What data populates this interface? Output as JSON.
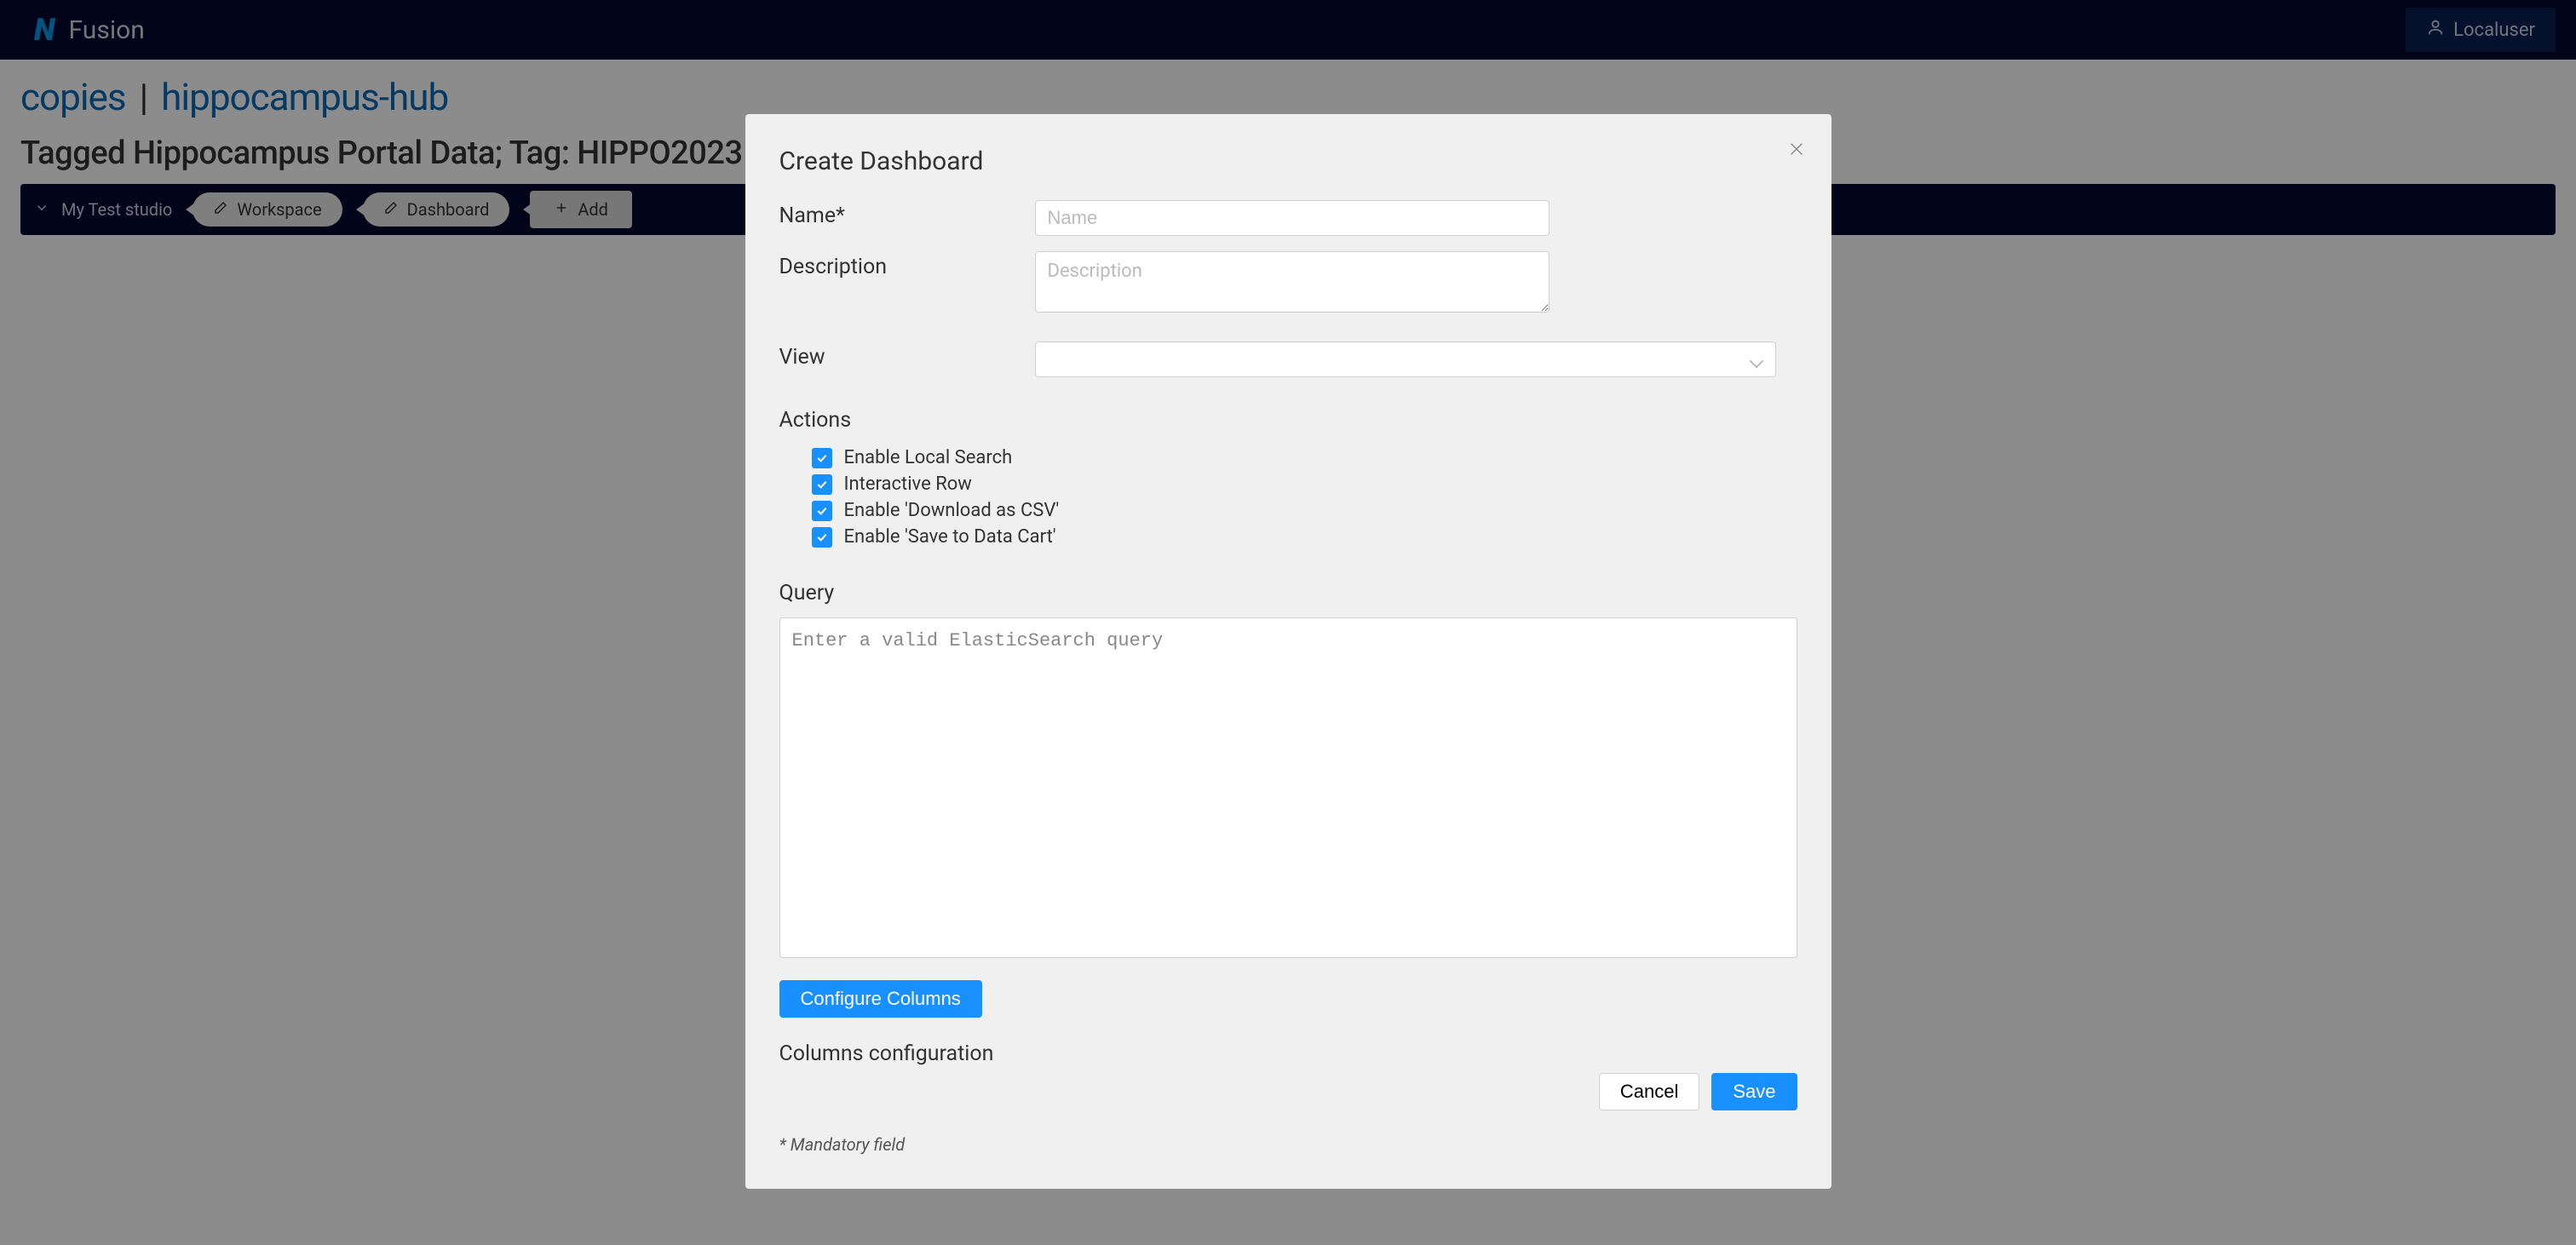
{
  "header": {
    "app_name": "Fusion",
    "logo_text": "N",
    "user_name": "Localuser"
  },
  "breadcrumb": {
    "part1": "copies",
    "sep": "|",
    "part2": "hippocampus-hub"
  },
  "page": {
    "title": "Tagged Hippocampus Portal Data; Tag: HIPPO2023"
  },
  "subbar": {
    "studio": "My Test studio",
    "workspace": "Workspace",
    "dashboard": "Dashboard",
    "add": "Add"
  },
  "modal": {
    "title": "Create Dashboard",
    "fields": {
      "name_label": "Name*",
      "name_placeholder": "Name",
      "description_label": "Description",
      "description_placeholder": "Description",
      "view_label": "View"
    },
    "actions_label": "Actions",
    "actions": [
      {
        "label": "Enable Local Search",
        "checked": true
      },
      {
        "label": "Interactive Row",
        "checked": true
      },
      {
        "label": "Enable 'Download as CSV'",
        "checked": true
      },
      {
        "label": "Enable 'Save to Data Cart'",
        "checked": true
      }
    ],
    "query_label": "Query",
    "query_placeholder": "Enter a valid ElasticSearch query",
    "configure_columns": "Configure Columns",
    "columns_config_label": "Columns configuration",
    "cancel": "Cancel",
    "save": "Save",
    "mandatory_note": "* Mandatory field"
  }
}
